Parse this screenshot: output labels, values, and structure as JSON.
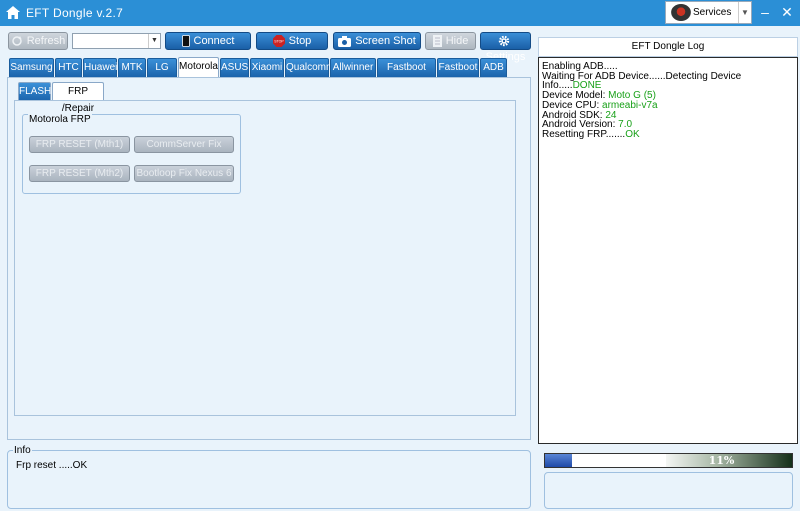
{
  "window": {
    "title": "EFT Dongle  v.2.7"
  },
  "services": {
    "label": "Services"
  },
  "toolbar": {
    "refresh": "Refresh",
    "combo_value": "",
    "connect": "Connect",
    "stop": "Stop",
    "screenshot": "Screen Shot",
    "hide": "Hide",
    "settings": "Settings"
  },
  "tabs": [
    "Samsung",
    "HTC",
    "Huawei",
    "MTK",
    "LG",
    "Motorola",
    "ASUS",
    "Xiaomi",
    "Qualcomm",
    "Allwinner",
    "Fastboot Root",
    "Fastboot",
    "ADB"
  ],
  "active_tab": "Motorola",
  "subtabs": [
    "FLASH",
    "FRP /Repair"
  ],
  "group": {
    "title": "Motorola FRP",
    "buttons": [
      "FRP RESET (Mth1)",
      "CommServer Fix",
      "FRP RESET (Mth2)",
      "Bootloop Fix Nexus 6"
    ]
  },
  "log": {
    "title": "EFT Dongle Log",
    "lines": [
      {
        "text": "Enabling ADB.....",
        "value": ""
      },
      {
        "text": "Waiting For ADB Device......Detecting Device Info.....",
        "value": "DONE"
      },
      {
        "text": "Device Model: ",
        "value": "Moto G (5)"
      },
      {
        "text": "Device CPU: ",
        "value": "armeabi-v7a"
      },
      {
        "text": "Android SDK: ",
        "value": "24"
      },
      {
        "text": "Android Version: ",
        "value": "7.0"
      },
      {
        "text": "Resetting FRP.......",
        "value": "OK"
      }
    ]
  },
  "info": {
    "title": "Info",
    "text": "Frp reset .....OK"
  },
  "progress": {
    "value": 0.11,
    "label": "11%"
  },
  "colors": {
    "titlebar": "#2b8fd6",
    "accent_blue": "#1b63ab",
    "ok_green": "#18a018",
    "stop_red": "#cc2222"
  }
}
